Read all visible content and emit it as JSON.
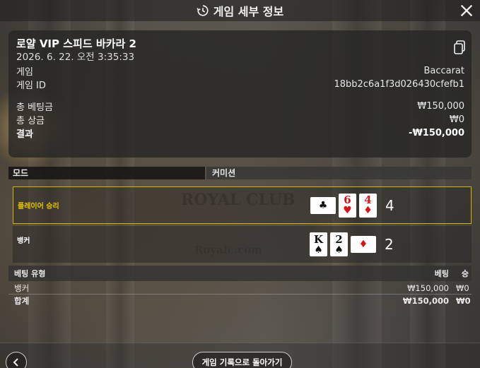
{
  "header": {
    "title": "게임 세부 정보"
  },
  "summary": {
    "game_name": "로얄 VIP 스피드 바카라 2",
    "datetime": "2026. 6. 22. 오전 3:35:33",
    "game_label": "게임",
    "game_value": "Baccarat",
    "game_id_label": "게임 ID",
    "game_id_value": "18bb2c6a1f3d026430cfefb1",
    "total_bet_label": "총 베팅금",
    "total_bet_value": "₩150,000",
    "total_win_label": "총 상금",
    "total_win_value": "₩0",
    "result_label": "결과",
    "result_value": "-₩150,000"
  },
  "mode_table": {
    "col_mode": "모드",
    "col_commission": "커미션"
  },
  "results": {
    "player": {
      "label": "플레이어 승리",
      "score": "4",
      "cards": [
        {
          "rank": "",
          "suit": "♣",
          "color": "#111111",
          "orientation": "landscape"
        },
        {
          "rank": "6",
          "suit": "♥",
          "color": "#d8121a",
          "orientation": "portrait"
        },
        {
          "rank": "4",
          "suit": "♦",
          "color": "#d8121a",
          "orientation": "portrait"
        }
      ]
    },
    "banker": {
      "label": "뱅커",
      "score": "2",
      "cards": [
        {
          "rank": "K",
          "suit": "♠",
          "color": "#111111",
          "orientation": "portrait"
        },
        {
          "rank": "2",
          "suit": "♠",
          "color": "#111111",
          "orientation": "portrait"
        },
        {
          "rank": "",
          "suit": "♦",
          "color": "#d8121a",
          "orientation": "landscape"
        }
      ]
    }
  },
  "bets": {
    "headers": {
      "type": "베팅 유형",
      "bet": "베팅",
      "win": "승"
    },
    "rows": [
      {
        "type": "뱅커",
        "bet": "₩150,000",
        "win": "₩0"
      }
    ],
    "total": {
      "type": "합계",
      "bet": "₩150,000",
      "win": "₩0"
    }
  },
  "footer": {
    "history_button": "게임 기록으로 돌아가기"
  },
  "watermark": {
    "brand": "ROYAL CLUB",
    "site": "Royalc.com"
  },
  "colors": {
    "highlight": "#d4b400",
    "card_red": "#d8121a"
  }
}
